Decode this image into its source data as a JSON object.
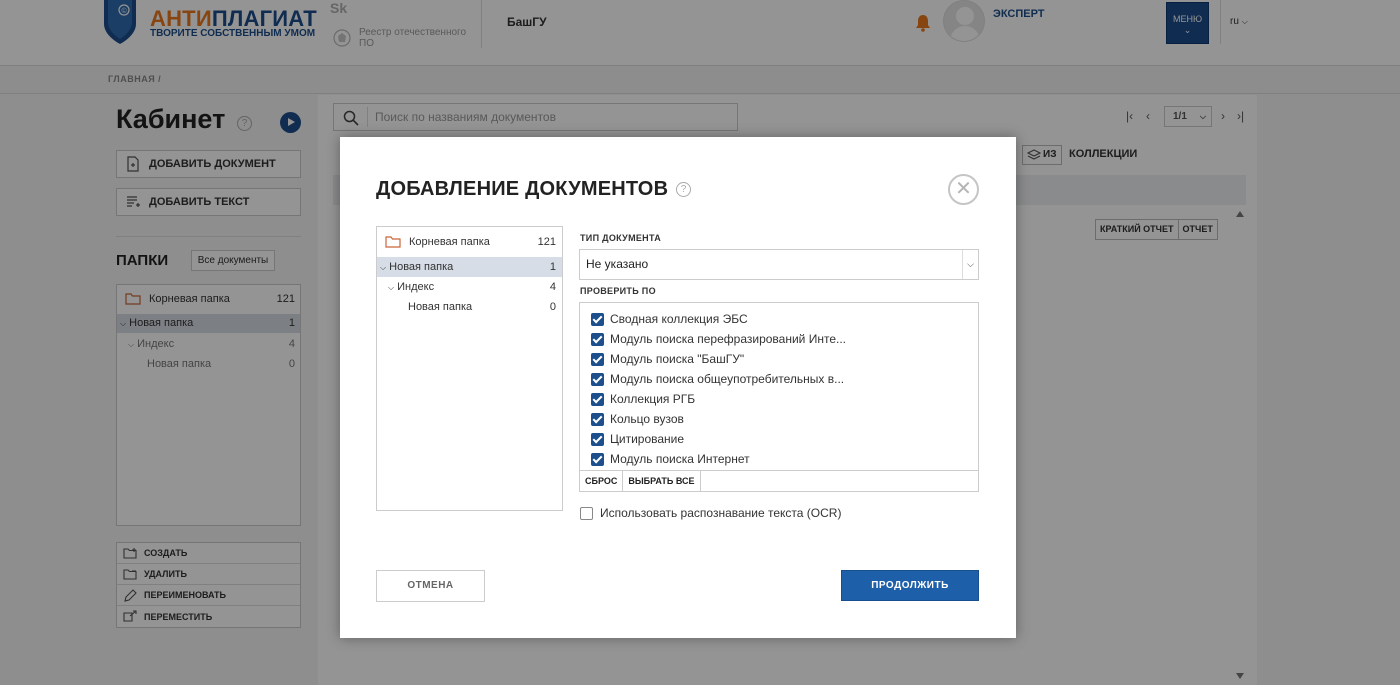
{
  "header": {
    "brand_part1": "АНТИ",
    "brand_part2": "ПЛАГИАТ",
    "slogan": "ТВОРИТЕ СОБСТВЕННЫМ УМОМ",
    "sk_logo": "Sk",
    "registry_text": "Реестр отечественного ПО",
    "organization": "БашГУ",
    "user_role": "ЭКСПЕРТ",
    "menu_label": "МЕНЮ",
    "language": "ru"
  },
  "breadcrumb": "ГЛАВНАЯ /",
  "sidebar": {
    "title": "Кабинет",
    "add_document": "ДОБАВИТЬ ДОКУМЕНТ",
    "add_text": "ДОБАВИТЬ ТЕКСТ",
    "folders_title": "ПАПКИ",
    "all_documents": "Все документы",
    "tree": [
      {
        "label": "Корневая папка",
        "count": "121"
      },
      {
        "label": "Новая папка",
        "count": "1"
      },
      {
        "label": "Индекс",
        "count": "4"
      },
      {
        "label": "Новая папка",
        "count": "0"
      }
    ],
    "actions": [
      "СОЗДАТЬ",
      "УДАЛИТЬ",
      "ПЕРЕИМЕНОВАТЬ",
      "ПЕРЕМЕСТИТЬ"
    ]
  },
  "main": {
    "search_placeholder": "Поиск по названиям документов",
    "page": "1/1",
    "from_label": "ИЗ",
    "collections_label": "КОЛЛЕКЦИИ",
    "short_report": "КРАТКИЙ ОТЧЕТ",
    "report": "ОТЧЕТ"
  },
  "modal": {
    "title": "ДОБАВЛЕНИЕ ДОКУМЕНТОВ",
    "tree": [
      {
        "label": "Корневая папка",
        "count": "121"
      },
      {
        "label": "Новая папка",
        "count": "1"
      },
      {
        "label": "Индекс",
        "count": "4"
      },
      {
        "label": "Новая папка",
        "count": "0"
      }
    ],
    "doc_type_label": "ТИП ДОКУМЕНТА",
    "doc_type_value": "Не указано",
    "check_by_label": "ПРОВЕРИТЬ ПО",
    "check_items": [
      "Сводная коллекция ЭБС",
      "Модуль поиска перефразирований Инте...",
      "Модуль поиска \"БашГУ\"",
      "Модуль поиска общеупотребительных в...",
      "Коллекция РГБ",
      "Кольцо вузов",
      "Цитирование",
      "Модуль поиска Интернет"
    ],
    "reset": "СБРОС",
    "select_all": "ВЫБРАТЬ ВСЕ",
    "ocr": "Использовать распознавание текста (OCR)",
    "cancel": "ОТМЕНА",
    "continue": "ПРОДОЛЖИТЬ"
  },
  "colors": {
    "brand_orange": "#e8791e",
    "brand_blue": "#1d4f8c",
    "primary_button": "#1d5fa8",
    "selected_row": "#d6dde6"
  }
}
